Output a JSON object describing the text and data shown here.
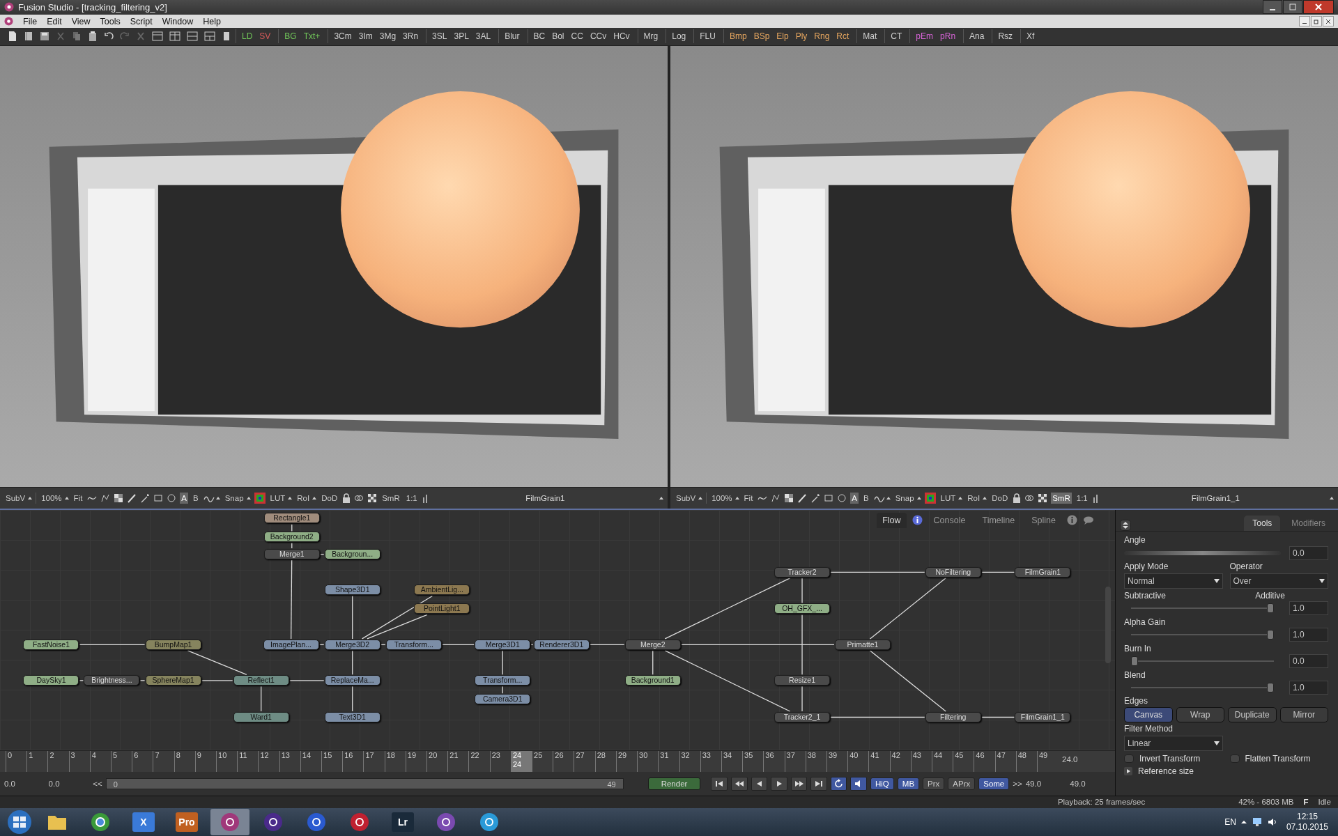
{
  "window": {
    "title": "Fusion Studio - [tracking_filtering_v2]"
  },
  "menu": [
    "File",
    "Edit",
    "View",
    "Tools",
    "Script",
    "Window",
    "Help"
  ],
  "tool_groups": [
    [
      {
        "label": "LD",
        "color": "#72c85a"
      },
      {
        "label": "SV",
        "color": "#d65a5a"
      }
    ],
    [
      {
        "label": "BG",
        "color": "#72c85a"
      },
      {
        "label": "Txt+",
        "color": "#72c85a"
      }
    ],
    [
      {
        "label": "3Cm",
        "color": "#d0d0d0"
      },
      {
        "label": "3Im",
        "color": "#d0d0d0"
      },
      {
        "label": "3Mg",
        "color": "#d0d0d0"
      },
      {
        "label": "3Rn",
        "color": "#d0d0d0"
      }
    ],
    [
      {
        "label": "3SL",
        "color": "#d0d0d0"
      },
      {
        "label": "3PL",
        "color": "#d0d0d0"
      },
      {
        "label": "3AL",
        "color": "#d0d0d0"
      }
    ],
    [
      {
        "label": "Blur",
        "color": "#d0d0d0"
      }
    ],
    [
      {
        "label": "BC",
        "color": "#d0d0d0"
      },
      {
        "label": "Bol",
        "color": "#d0d0d0"
      },
      {
        "label": "CC",
        "color": "#d0d0d0"
      },
      {
        "label": "CCv",
        "color": "#d0d0d0"
      },
      {
        "label": "HCv",
        "color": "#d0d0d0"
      }
    ],
    [
      {
        "label": "Mrg",
        "color": "#d0d0d0"
      }
    ],
    [
      {
        "label": "Log",
        "color": "#d0d0d0"
      }
    ],
    [
      {
        "label": "FLU",
        "color": "#d0d0d0"
      }
    ],
    [
      {
        "label": "Bmp",
        "color": "#e8a860"
      },
      {
        "label": "BSp",
        "color": "#e8a860"
      },
      {
        "label": "Elp",
        "color": "#e8a860"
      },
      {
        "label": "Ply",
        "color": "#e8a860"
      },
      {
        "label": "Rng",
        "color": "#e8a860"
      },
      {
        "label": "Rct",
        "color": "#e8a860"
      }
    ],
    [
      {
        "label": "Mat",
        "color": "#d0d0d0"
      }
    ],
    [
      {
        "label": "CT",
        "color": "#d0d0d0"
      }
    ],
    [
      {
        "label": "pEm",
        "color": "#d864d8"
      },
      {
        "label": "pRn",
        "color": "#d864d8"
      }
    ],
    [
      {
        "label": "Ana",
        "color": "#d0d0d0"
      }
    ],
    [
      {
        "label": "Rsz",
        "color": "#d0d0d0"
      }
    ],
    [
      {
        "label": "Xf",
        "color": "#d0d0d0"
      }
    ]
  ],
  "viewers": [
    {
      "subview": "SubV",
      "zoom": "100%",
      "fit": "Fit",
      "buffers": [
        {
          "label": "A",
          "selected": true
        },
        {
          "label": "B",
          "selected": false
        }
      ],
      "snap": "Snap",
      "lut": "LUT",
      "roi": "RoI",
      "dod": "DoD",
      "smr": {
        "label": "SmR",
        "selected": false
      },
      "ratio": "1:1",
      "title": "FilmGrain1"
    },
    {
      "subview": "SubV",
      "zoom": "100%",
      "fit": "Fit",
      "buffers": [
        {
          "label": "A",
          "selected": true
        },
        {
          "label": "B",
          "selected": false
        }
      ],
      "snap": "Snap",
      "lut": "LUT",
      "roi": "RoI",
      "dod": "DoD",
      "smr": {
        "label": "SmR",
        "selected": true
      },
      "ratio": "1:1",
      "title": "FilmGrain1_1"
    }
  ],
  "flow": {
    "tabs": [
      {
        "label": "Flow",
        "selected": true
      },
      {
        "label": "Console",
        "selected": false
      },
      {
        "label": "Timeline",
        "selected": false
      },
      {
        "label": "Spline",
        "selected": false
      }
    ],
    "nodes": [
      {
        "label": "Rectangle1",
        "color": "#a08c7c"
      },
      {
        "label": "Background2",
        "color": "#8fae86"
      },
      {
        "label": "Merge1",
        "color": "#4a4a4a"
      },
      {
        "label": "Backgroun...",
        "color": "#8fae86"
      },
      {
        "label": "Shape3D1",
        "color": "#7c8ea6"
      },
      {
        "label": "AmbientLig...",
        "color": "#8c7850"
      },
      {
        "label": "PointLight1",
        "color": "#8c7850"
      },
      {
        "label": "FastNoise1",
        "color": "#8fae86"
      },
      {
        "label": "BumpMap1",
        "color": "#86845e"
      },
      {
        "label": "ImagePlan...",
        "color": "#7c8ea6"
      },
      {
        "label": "Merge3D2",
        "color": "#7c8ea6"
      },
      {
        "label": "Transform...",
        "color": "#7c8ea6"
      },
      {
        "label": "Merge3D1",
        "color": "#7c8ea6"
      },
      {
        "label": "Renderer3D1",
        "color": "#7c8ea6"
      },
      {
        "label": "Merge2",
        "color": "#4a4a4a"
      },
      {
        "label": "DaySky1",
        "color": "#8fae86"
      },
      {
        "label": "Brightness...",
        "color": "#4a4a4a"
      },
      {
        "label": "SphereMap1",
        "color": "#86845e"
      },
      {
        "label": "Reflect1",
        "color": "#6e8c84"
      },
      {
        "label": "ReplaceMa...",
        "color": "#7c8ea6"
      },
      {
        "label": "Transform...",
        "color": "#7c8ea6"
      },
      {
        "label": "Background1",
        "color": "#8fae86"
      },
      {
        "label": "Camera3D1",
        "color": "#7c8ea6"
      },
      {
        "label": "Ward1",
        "color": "#6e8c84"
      },
      {
        "label": "Text3D1",
        "color": "#7c8ea6"
      },
      {
        "label": "Tracker2",
        "color": "#4a4a4a"
      },
      {
        "label": "NoFiltering",
        "color": "#4a4a4a"
      },
      {
        "label": "FilmGrain1",
        "color": "#4a4a4a"
      },
      {
        "label": "OH_GFX_...",
        "color": "#8fae86"
      },
      {
        "label": "Primatte1",
        "color": "#4a4a4a"
      },
      {
        "label": "Resize1",
        "color": "#4a4a4a"
      },
      {
        "label": "Tracker2_1",
        "color": "#4a4a4a"
      },
      {
        "label": "Filtering",
        "color": "#4a4a4a"
      },
      {
        "label": "FilmGrain1_1",
        "color": "#4a4a4a"
      }
    ]
  },
  "timeline": {
    "ticks": [
      {
        "label": "0",
        "selected": false
      },
      {
        "label": "1",
        "selected": false
      },
      {
        "label": "2",
        "selected": false
      },
      {
        "label": "3",
        "selected": false
      },
      {
        "label": "4",
        "selected": false
      },
      {
        "label": "5",
        "selected": false
      },
      {
        "label": "6",
        "selected": false
      },
      {
        "label": "7",
        "selected": false
      },
      {
        "label": "8",
        "selected": false
      },
      {
        "label": "9",
        "selected": false
      },
      {
        "label": "10",
        "selected": false
      },
      {
        "label": "11",
        "selected": false
      },
      {
        "label": "12",
        "selected": false
      },
      {
        "label": "13",
        "selected": false
      },
      {
        "label": "14",
        "selected": false
      },
      {
        "label": "15",
        "selected": false
      },
      {
        "label": "16",
        "selected": false
      },
      {
        "label": "17",
        "selected": false
      },
      {
        "label": "18",
        "selected": false
      },
      {
        "label": "19",
        "selected": false
      },
      {
        "label": "20",
        "selected": false
      },
      {
        "label": "21",
        "selected": false
      },
      {
        "label": "22",
        "selected": false
      },
      {
        "label": "23",
        "selected": false
      },
      {
        "label": "24",
        "selected": true,
        "sub": "24"
      },
      {
        "label": "25",
        "selected": false
      },
      {
        "label": "26",
        "selected": false
      },
      {
        "label": "27",
        "selected": false
      },
      {
        "label": "28",
        "selected": false
      },
      {
        "label": "29",
        "selected": false
      },
      {
        "label": "30",
        "selected": false
      },
      {
        "label": "31",
        "selected": false
      },
      {
        "label": "32",
        "selected": false
      },
      {
        "label": "33",
        "selected": false
      },
      {
        "label": "34",
        "selected": false
      },
      {
        "label": "35",
        "selected": false
      },
      {
        "label": "36",
        "selected": false
      },
      {
        "label": "37",
        "selected": false
      },
      {
        "label": "38",
        "selected": false
      },
      {
        "label": "39",
        "selected": false
      },
      {
        "label": "40",
        "selected": false
      },
      {
        "label": "41",
        "selected": false
      },
      {
        "label": "42",
        "selected": false
      },
      {
        "label": "43",
        "selected": false
      },
      {
        "label": "44",
        "selected": false
      },
      {
        "label": "45",
        "selected": false
      },
      {
        "label": "46",
        "selected": false
      },
      {
        "label": "47",
        "selected": false
      },
      {
        "label": "48",
        "selected": false
      },
      {
        "label": "49",
        "selected": false
      }
    ],
    "current_time": "24.0",
    "global_start": "0.0",
    "render_start": "0.0",
    "rewind": "<<",
    "range": {
      "start": "0",
      "end": "49",
      "level": 1
    },
    "render": "Render",
    "toggles": [
      {
        "label": "HiQ",
        "on": true
      },
      {
        "label": "MB",
        "on": true
      },
      {
        "label": "Prx",
        "on": false
      },
      {
        "label": "APrx",
        "on": false
      },
      {
        "label": "Some",
        "on": true
      }
    ],
    "forward": ">>",
    "render_end": "49.0",
    "global_end": "49.0"
  },
  "inspector": {
    "tabs": [
      {
        "label": "Tools",
        "selected": true
      },
      {
        "label": "Modifiers",
        "selected": false
      }
    ],
    "angle": {
      "label": "Angle",
      "value": "0.0"
    },
    "apply_mode": {
      "label": "Apply Mode",
      "value": "Normal"
    },
    "operator": {
      "label": "Operator",
      "value": "Over"
    },
    "sliders": [
      {
        "label": "Subtractive",
        "label_right": "Additive",
        "level": 1,
        "value": "1.0"
      },
      {
        "label": "Alpha Gain",
        "level": 1,
        "value": "1.0"
      },
      {
        "label": "Burn In",
        "level": 0,
        "value": "0.0"
      },
      {
        "label": "Blend",
        "level": 1,
        "value": "1.0"
      }
    ],
    "edges": {
      "label": "Edges",
      "options": [
        {
          "label": "Canvas",
          "selected": true
        },
        {
          "label": "Wrap",
          "selected": false
        },
        {
          "label": "Duplicate",
          "selected": false
        },
        {
          "label": "Mirror",
          "selected": false
        }
      ]
    },
    "filter_method": {
      "label": "Filter Method",
      "value": "Linear"
    },
    "checkboxes": [
      {
        "label": "Invert Transform",
        "checked": false
      },
      {
        "label": "Flatten Transform",
        "checked": false
      }
    ],
    "reference_size": {
      "label": "Reference size",
      "expanded": false
    }
  },
  "status_bar": {
    "playback": "Playback: 25 frames/sec",
    "memory": "42% - 6803 MB",
    "state_letter": "F",
    "state": "Idle"
  },
  "taskbar": {
    "apps": [
      {
        "kind": "folder",
        "color": "#e8c050",
        "selected": false
      },
      {
        "kind": "globe",
        "color": "#3a9a3a",
        "selected": false
      },
      {
        "kind": "label",
        "label": "X",
        "color": "#3a7ad8",
        "selected": false
      },
      {
        "kind": "label",
        "label": "Pro",
        "color": "#c06020",
        "selected": false
      },
      {
        "kind": "orb",
        "color": "#a0387a",
        "selected": true
      },
      {
        "kind": "orb",
        "color": "#4a2a8a",
        "selected": false
      },
      {
        "kind": "orb",
        "color": "#2a5ad0",
        "selected": false
      },
      {
        "kind": "orb",
        "color": "#c02030",
        "selected": false
      },
      {
        "kind": "label",
        "label": "Lr",
        "color": "#1a2a3a",
        "selected": false
      },
      {
        "kind": "orb",
        "color": "#7a4ab0",
        "selected": false
      },
      {
        "kind": "orb",
        "color": "#2a9ad8",
        "selected": false
      }
    ],
    "language": "EN",
    "time": "12:15",
    "date": "07.10.2015"
  }
}
